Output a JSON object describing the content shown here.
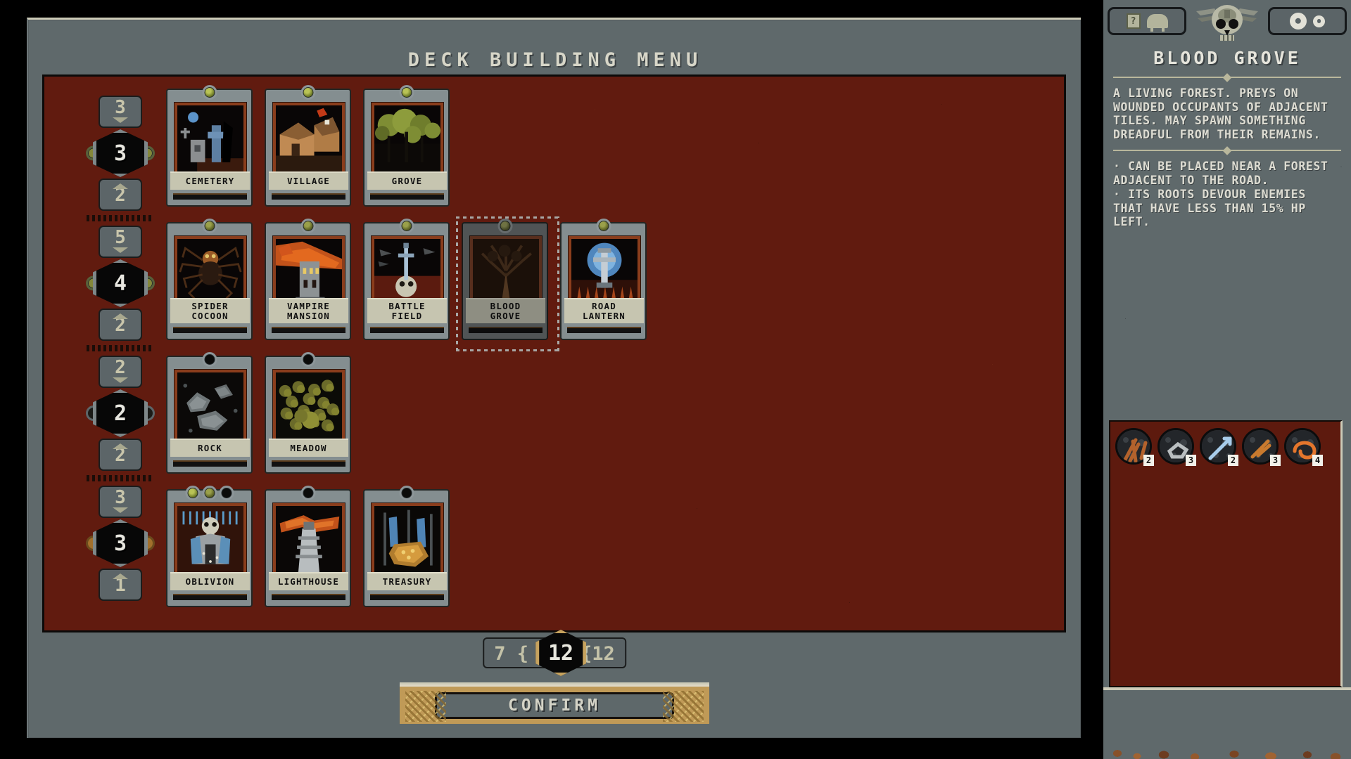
{
  "window": {
    "title": "DECK BUILDING MENU"
  },
  "cost_rail": {
    "groups": [
      {
        "up": "3",
        "value": "3",
        "down": "2",
        "stud": "gem"
      },
      {
        "up": "5",
        "value": "4",
        "down": "2",
        "stud": "gem"
      },
      {
        "up": "2",
        "value": "2",
        "down": "2",
        "stud": "plain"
      },
      {
        "up": "3",
        "value": "3",
        "down": "1",
        "stud": "gold"
      }
    ]
  },
  "cards": {
    "rows": [
      [
        {
          "name_line1": "CEMETERY",
          "name_line2": "",
          "gems": [
            "green"
          ],
          "art": "cemetery",
          "selected": false
        },
        {
          "name_line1": "VILLAGE",
          "name_line2": "",
          "gems": [
            "green"
          ],
          "art": "village",
          "selected": false
        },
        {
          "name_line1": "GROVE",
          "name_line2": "",
          "gems": [
            "green"
          ],
          "art": "grove",
          "selected": false
        }
      ],
      [
        {
          "name_line1": "SPIDER",
          "name_line2": "COCOON",
          "gems": [
            "olive"
          ],
          "art": "spider",
          "selected": false
        },
        {
          "name_line1": "VAMPIRE",
          "name_line2": "MANSION",
          "gems": [
            "olive"
          ],
          "art": "mansion",
          "selected": false
        },
        {
          "name_line1": "BATTLE",
          "name_line2": "FIELD",
          "gems": [
            "olive"
          ],
          "art": "battlefield",
          "selected": false
        },
        {
          "name_line1": "BLOOD",
          "name_line2": "GROVE",
          "gems": [
            "olive"
          ],
          "art": "bloodgrove",
          "selected": true
        },
        {
          "name_line1": "ROAD",
          "name_line2": "LANTERN",
          "gems": [
            "olive"
          ],
          "art": "lantern",
          "selected": false
        }
      ],
      [
        {
          "name_line1": "ROCK",
          "name_line2": "",
          "gems": [
            "empty"
          ],
          "art": "rock",
          "selected": false
        },
        {
          "name_line1": "MEADOW",
          "name_line2": "",
          "gems": [
            "empty"
          ],
          "art": "meadow",
          "selected": false
        }
      ],
      [
        {
          "name_line1": "OBLIVION",
          "name_line2": "",
          "gems": [
            "green",
            "olive",
            "empty"
          ],
          "art": "oblivion",
          "selected": false
        },
        {
          "name_line1": "LIGHTHOUSE",
          "name_line2": "",
          "gems": [
            "empty"
          ],
          "art": "lighthouse",
          "selected": false
        },
        {
          "name_line1": "TREASURY",
          "name_line2": "",
          "gems": [
            "empty"
          ],
          "art": "treasury",
          "selected": false
        }
      ]
    ]
  },
  "counter": {
    "left": "7 {",
    "center": "12",
    "right": "{12"
  },
  "confirm": {
    "label": "CONFIRM"
  },
  "sidebar": {
    "topbar": {
      "help_icon": "book-icon",
      "bag_icon": "bestiary-icon",
      "emblem": "skull-emblem",
      "gear_icon": "gear-icon",
      "gear_small_icon": "gear-small-icon"
    },
    "card_title": "BLOOD GROVE",
    "description": "A LIVING FOREST. PREYS ON WOUNDED OCCUPANTS OF ADJACENT TILES. MAY SPAWN SOMETHING DREADFUL FROM THEIR REMAINS.",
    "bullets": [
      "· CAN BE PLACED NEAR A FOREST ADJACENT TO THE ROAD.",
      "· ITS ROOTS DEVOUR ENEMIES THAT HAVE LESS THAN 15% HP LEFT."
    ],
    "deck_items": [
      {
        "icon": "branches-icon",
        "count": "2"
      },
      {
        "icon": "stone-icon",
        "count": "3"
      },
      {
        "icon": "spear-icon",
        "count": "2"
      },
      {
        "icon": "torch-icon",
        "count": "3"
      },
      {
        "icon": "serpent-icon",
        "count": "4"
      }
    ]
  },
  "colors": {
    "panel_gray": "#5f696b",
    "board_red": "#611b0f",
    "plate_cream": "#c6c5b0",
    "gold": "#c09a57",
    "text_light": "#dddcd2"
  }
}
